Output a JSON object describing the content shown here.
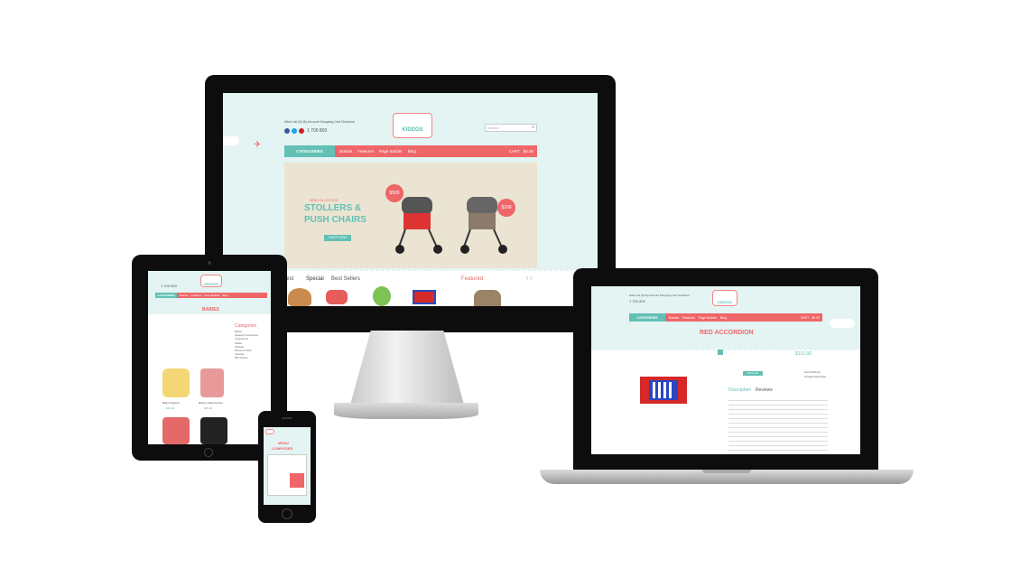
{
  "desktop": {
    "top_links": "Wish List (0)  My Account  Shopping Cart  Checkout",
    "phone": "1 700 800",
    "logo": "KIDDOS",
    "search_placeholder": "Search",
    "nav": {
      "categories": "CATEGORIES",
      "items": [
        "Brands",
        "Features",
        "Page Builder",
        "Blog"
      ],
      "cart": "CART",
      "cart_total": "$0.00"
    },
    "banner": {
      "kicker": "NEW COLLECTION",
      "title_line1": "STOLLERS &",
      "title_line2": "PUSH CHAIRS",
      "button": "SHOP NOW",
      "price_tag_1": "$500",
      "price_tag_2": "$299"
    },
    "tabs": [
      "Latest",
      "Special",
      "Best Sellers"
    ],
    "featured": "Featured"
  },
  "tablet": {
    "logo": "KIDDOS",
    "phone": "1 700 800",
    "categories": "CATEGORIES",
    "nav_items": [
      "Brands",
      "Features",
      "Page Builder",
      "Blog"
    ],
    "page_title": "BABIES",
    "sidebar_title": "Categories",
    "sidebar_items": [
      "Babies",
      "Apparel & Accessories",
      "Components",
      "Tablets",
      "Software",
      "Phones & PDAs",
      "Cameras",
      "MP3 Players"
    ],
    "products": [
      {
        "name": "Baby bodysuit",
        "price": "$49.00"
      },
      {
        "name": "Bolero striped dress",
        "price": "$55.00"
      }
    ]
  },
  "phone": {
    "title_line1": "MENU",
    "title_line2": "COMPOSER"
  },
  "laptop": {
    "top_links": "Wish List (0)  My Account  Shopping Cart  Checkout",
    "phone": "1 700 800",
    "logo": "KIDDOS",
    "categories": "CATEGORIES",
    "nav_items": [
      "Brands",
      "Features",
      "Page Builder",
      "Blog"
    ],
    "cart": "CART",
    "cart_total": "$0.00",
    "product_title": "RED ACCORDION",
    "price": "$122.00",
    "add_to_cart": "Add to cart",
    "wishlist": "Add to Wish List",
    "compare": "Compare this Product",
    "tabs": [
      "Description",
      "Reviews"
    ]
  },
  "colors": {
    "mint": "#e3f4f3",
    "teal": "#63c0b5",
    "coral": "#ef6668"
  }
}
